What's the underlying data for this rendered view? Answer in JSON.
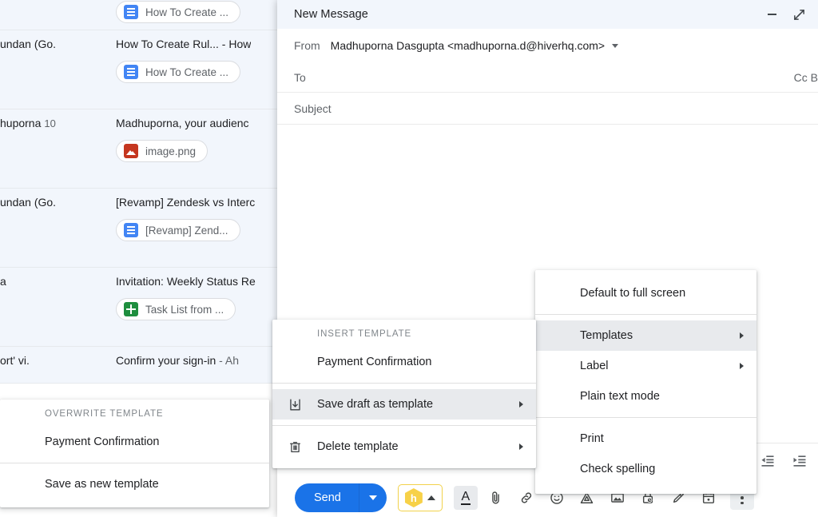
{
  "inbox": {
    "rows": [
      {
        "sender": "",
        "count": "",
        "subject": "",
        "snippet": "",
        "chip": {
          "label": "How To Create ...",
          "icon": "google-docs-icon",
          "kind": "docs"
        },
        "partial_top": true
      },
      {
        "sender": "undan (Go.",
        "count": "",
        "subject": "How To Create Rul... - How",
        "snippet": "",
        "chip": {
          "label": "How To Create ...",
          "icon": "google-docs-icon",
          "kind": "docs"
        }
      },
      {
        "sender": "huporna",
        "count": "10",
        "subject": "Madhuporna, your audienc",
        "snippet": "",
        "chip": {
          "label": "image.png",
          "icon": "image-file-icon",
          "kind": "img"
        }
      },
      {
        "sender": "undan (Go.",
        "count": "",
        "subject": "[Revamp] Zendesk vs Interc",
        "snippet": "",
        "chip": {
          "label": "[Revamp] Zend...",
          "icon": "google-docs-icon",
          "kind": "docs"
        }
      },
      {
        "sender": "a",
        "count": "",
        "subject": "Invitation: Weekly Status Re",
        "snippet": "",
        "chip": {
          "label": "Task List from ...",
          "icon": "google-sheets-icon",
          "kind": "sheets"
        }
      },
      {
        "sender": "ort' vi.",
        "count": "",
        "subject": "Confirm your sign-in",
        "snippet": " - Ah",
        "chip": null
      }
    ]
  },
  "compose": {
    "title": "New Message",
    "minimize_label": "minimize",
    "expand_label": "full screen",
    "from": {
      "label": "From",
      "value": "Madhuporna Dasgupta <madhuporna.d@hiverhq.com>"
    },
    "to": {
      "label": "To",
      "cc_bcc": "Cc B"
    },
    "subject": {
      "placeholder": "Subject"
    },
    "body": {
      "value": ""
    },
    "send": {
      "label": "Send",
      "dropdown_label": "send options"
    },
    "hiver": {
      "logo_text": "h",
      "expand_label": "expand hiver panel"
    },
    "toolbar_icons": [
      {
        "name": "formatting-options-icon",
        "glyph": "A",
        "active": true
      },
      {
        "name": "attach-file-icon"
      },
      {
        "name": "insert-link-icon"
      },
      {
        "name": "insert-emoji-icon"
      },
      {
        "name": "insert-drive-file-icon"
      },
      {
        "name": "insert-photo-icon"
      },
      {
        "name": "confidential-mode-icon"
      },
      {
        "name": "insert-signature-icon"
      },
      {
        "name": "schedule-send-icon",
        "badge": true
      },
      {
        "name": "more-options-icon"
      }
    ],
    "format_icons": [
      {
        "name": "indent-less-icon"
      },
      {
        "name": "indent-more-icon"
      }
    ]
  },
  "menu_more": {
    "items": [
      {
        "label": "Default to full screen",
        "submenu": false,
        "highlight": false,
        "icon": null
      },
      {
        "separator": true
      },
      {
        "label": "Templates",
        "submenu": true,
        "highlight": true,
        "icon": null
      },
      {
        "label": "Label",
        "submenu": true,
        "highlight": false,
        "icon": null
      },
      {
        "label": "Plain text mode",
        "submenu": false,
        "highlight": false,
        "icon": null
      },
      {
        "separator": true
      },
      {
        "label": "Print",
        "submenu": false,
        "highlight": false,
        "icon": null
      },
      {
        "label": "Check spelling",
        "submenu": false,
        "highlight": false,
        "icon": null
      }
    ]
  },
  "menu_templates": {
    "header": "INSERT TEMPLATE",
    "items": [
      {
        "label": "Payment Confirmation",
        "submenu": false,
        "highlight": false,
        "icon": null
      },
      {
        "separator": true
      },
      {
        "label": "Save draft as template",
        "submenu": true,
        "highlight": true,
        "icon": "save-draft-icon"
      },
      {
        "separator": true
      },
      {
        "label": "Delete template",
        "submenu": true,
        "highlight": false,
        "icon": "trash-icon"
      }
    ]
  },
  "menu_save": {
    "header": "OVERWRITE TEMPLATE",
    "items": [
      {
        "label": "Payment Confirmation",
        "submenu": false,
        "highlight": false,
        "icon": null
      },
      {
        "separator": true
      },
      {
        "label": "Save as new template",
        "submenu": false,
        "highlight": false,
        "icon": null
      }
    ]
  },
  "colors": {
    "accent_blue": "#1a73e8",
    "header_bg": "#f2f6fc",
    "menu_highlight": "#e8eaed",
    "hiver_yellow": "#f7d148"
  }
}
